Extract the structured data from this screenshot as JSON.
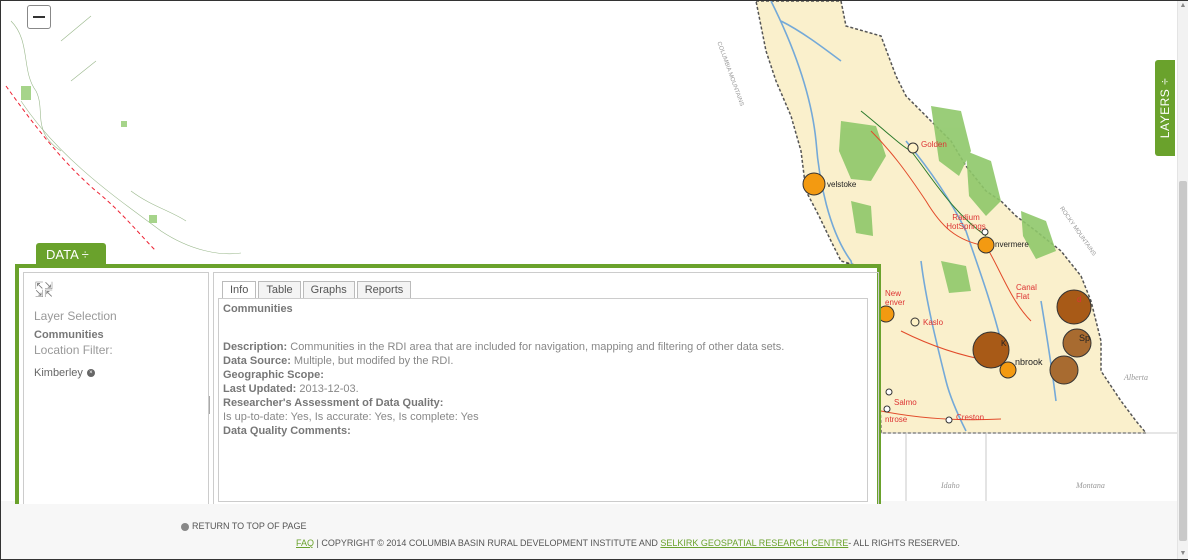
{
  "map": {
    "zoom_out_label": "−",
    "towns": [
      {
        "label": "Golden",
        "color": "red"
      },
      {
        "label": "Revelstoke",
        "display": "velstoke",
        "color": "black"
      },
      {
        "label": "Radium HotSprings",
        "color": "red"
      },
      {
        "label": "Invermere",
        "display": "nvermere",
        "color": "black"
      },
      {
        "label": "Canal Flats",
        "display": "Canal Flat",
        "color": "red"
      },
      {
        "label": "New Denver",
        "display": "New\nenver",
        "color": "red"
      },
      {
        "label": "Kaslo",
        "color": "red"
      },
      {
        "label": "Kimberley",
        "display": "K",
        "color": "black"
      },
      {
        "label": "Cranbrook",
        "display": "nbrook",
        "color": "black"
      },
      {
        "label": "Sparwood",
        "display": "Sp",
        "color": "black"
      },
      {
        "label": "Salmo",
        "color": "red"
      },
      {
        "label": "Creston",
        "color": "red"
      },
      {
        "label": "Montrose",
        "display": "ntrose",
        "color": "red"
      }
    ],
    "regions": [
      "Alberta",
      "Idaho",
      "Montana"
    ],
    "features": [
      "COLUMBIA MOUNTAINS",
      "ROCKY MOUNTAINS"
    ]
  },
  "layers_tab": {
    "label": "LAYERS ÷"
  },
  "data_tab": {
    "label": "DATA ÷"
  },
  "left_pane": {
    "layer_selection": "Layer Selection",
    "layer_name": "Communities",
    "location_filter": "Location Filter:",
    "filter_value": "Kimberley"
  },
  "tabs": [
    "Info",
    "Table",
    "Graphs",
    "Reports"
  ],
  "info": {
    "title": "Communities",
    "description_label": "Description:",
    "description": " Communities in the RDI area that are included for navigation, mapping and filtering of other data sets.",
    "source_label": "Data Source:",
    "source": " Multiple, but modifed by the RDI.",
    "scope_label": "Geographic Scope:",
    "updated_label": "Last Updated:",
    "updated": " 2013-12-03.",
    "assessment_label": "Researcher's Assessment of Data Quality:",
    "assessment": "Is up-to-date: Yes, Is accurate: Yes, Is complete: Yes",
    "comments_label": "Data Quality Comments:"
  },
  "footer": {
    "return_top": "RETURN TO TOP OF PAGE",
    "faq": "FAQ",
    "copyright_pre": " | COPYRIGHT © 2014 COLUMBIA BASIN RURAL DEVELOPMENT INSTITUTE AND ",
    "selkirk": "SELKIRK GEOSPATIAL RESEARCH CENTRE",
    "copyright_post": "- ALL RIGHTS RESERVED."
  },
  "colors": {
    "accent_green": "#6aa22c",
    "map_region": "#faf0cc",
    "park_green": "#8fc86a",
    "water_blue": "#74a9d8",
    "marker_orange": "#f39a11",
    "marker_brown": "#a85a17"
  }
}
